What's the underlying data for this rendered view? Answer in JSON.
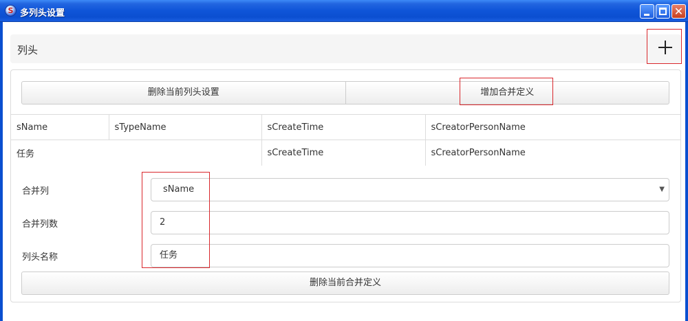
{
  "window": {
    "title": "多列头设置",
    "app_icon_letter": "S"
  },
  "section": {
    "title": "列头",
    "add_icon": "plus-icon"
  },
  "actions": {
    "delete_header_label": "删除当前列头设置",
    "add_merge_label": "增加合并定义"
  },
  "header_rows": [
    [
      "sName",
      "sTypeName",
      "sCreateTime",
      "sCreatorPersonName"
    ],
    [
      "任务",
      "sCreateTime",
      "sCreatorPersonName"
    ]
  ],
  "form": {
    "merge_column_label": "合并列",
    "merge_column_value": "sName",
    "merge_count_label": "合并列数",
    "merge_count_value": "2",
    "header_name_label": "列头名称",
    "header_name_value": "任务",
    "delete_merge_label": "删除当前合并定义"
  },
  "colors": {
    "highlight": "#d9262b",
    "titlebar": "#0b4fd1"
  }
}
